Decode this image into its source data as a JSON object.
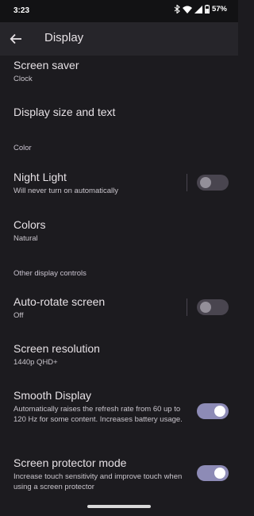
{
  "status_bar": {
    "time": "3:23",
    "battery_percent": "57%",
    "icons": [
      "bluetooth-icon",
      "wifi-icon",
      "cellular-signal-icon",
      "battery-icon"
    ]
  },
  "header": {
    "title": "Display",
    "back_icon": "arrow-back-icon"
  },
  "settings": {
    "screen_saver": {
      "title": "Screen saver",
      "subtitle": "Clock"
    },
    "display_size": {
      "title": "Display size and text"
    },
    "color_section": "Color",
    "night_light": {
      "title": "Night Light",
      "subtitle": "Will never turn on automatically",
      "enabled": false
    },
    "colors": {
      "title": "Colors",
      "subtitle": "Natural"
    },
    "other_section": "Other display controls",
    "auto_rotate": {
      "title": "Auto-rotate screen",
      "subtitle": "Off",
      "enabled": false
    },
    "screen_resolution": {
      "title": "Screen resolution",
      "subtitle": "1440p QHD+"
    },
    "smooth_display": {
      "title": "Smooth Display",
      "subtitle": "Automatically raises the refresh rate from 60 up to 120 Hz for some content. Increases battery usage.",
      "enabled": true
    },
    "screen_protector": {
      "title": "Screen protector mode",
      "subtitle": "Increase touch sensitivity and improve touch when using a screen protector",
      "enabled": true
    }
  },
  "colors": {
    "background": "#1c1b1f",
    "app_bar": "#26252a",
    "toggle_on": "#8d8bb6",
    "toggle_off": "#49454f"
  }
}
